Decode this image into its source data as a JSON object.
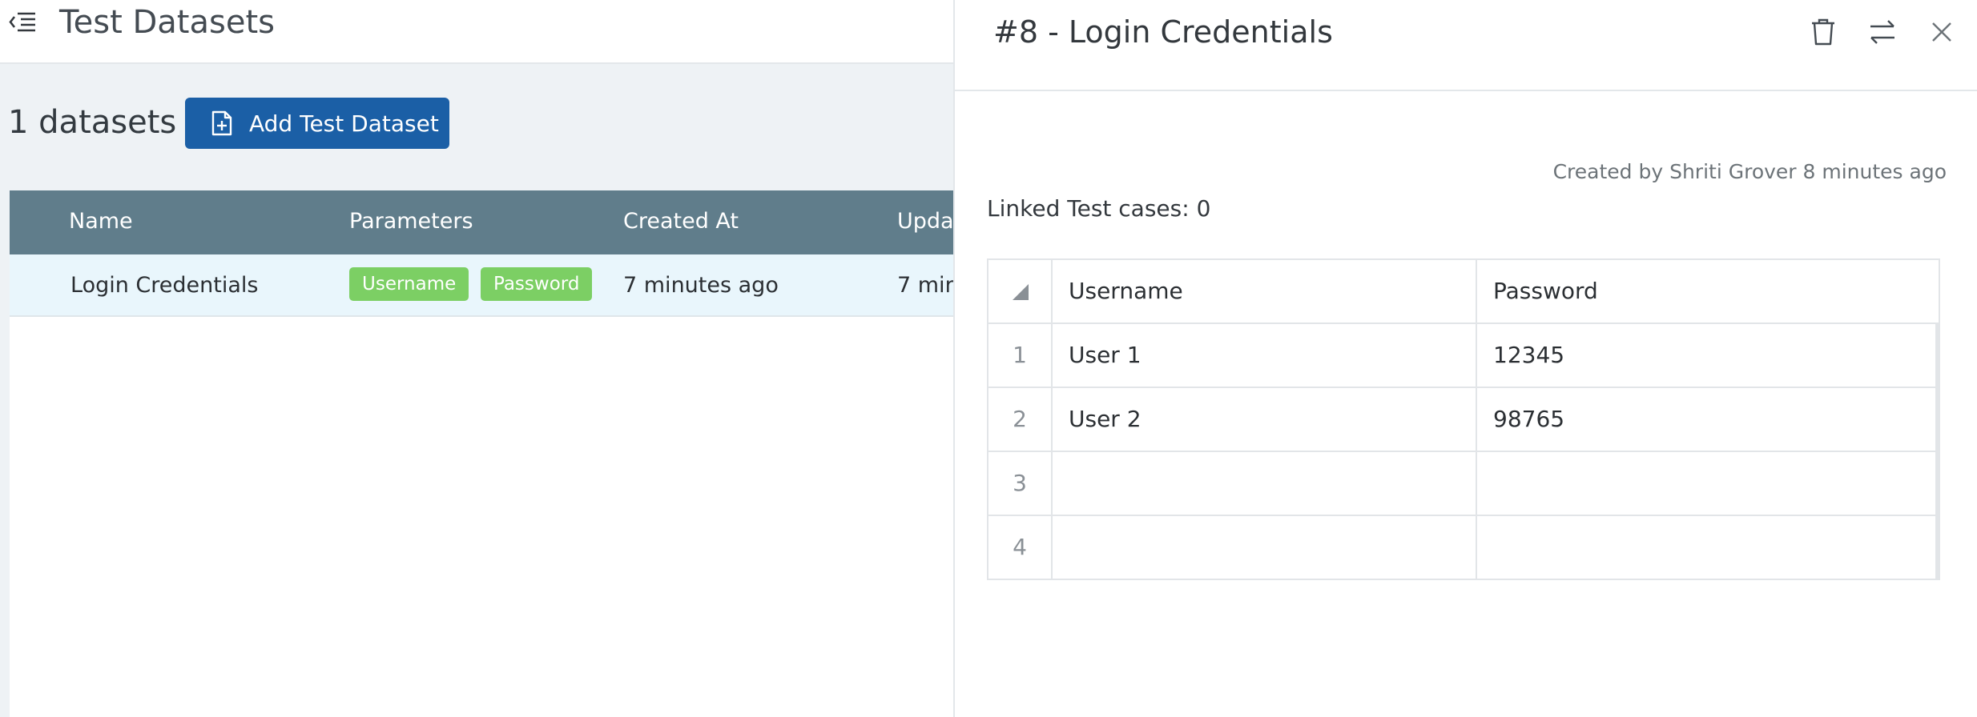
{
  "header": {
    "title": "Test Datasets",
    "menu_icon": "menu-collapse-icon"
  },
  "toolbar": {
    "count_label": "1 datasets",
    "add_button_label": "Add Test Dataset",
    "add_button_icon": "file-plus-icon"
  },
  "datasets_table": {
    "columns": [
      "Name",
      "Parameters",
      "Created At",
      "Upda"
    ],
    "rows": [
      {
        "name": "Login Credentials",
        "parameters": [
          "Username",
          "Password"
        ],
        "created_at": "7 minutes ago",
        "updated_at": "7 min"
      }
    ]
  },
  "drawer": {
    "title": "#8 - Login Credentials",
    "icons": [
      "trash-icon",
      "swap-icon",
      "close-icon"
    ],
    "created_by": "Created by Shriti Grover 8 minutes ago",
    "linked_cases": "Linked Test cases: 0",
    "grid": {
      "columns": [
        "Username",
        "Password"
      ],
      "rows": [
        {
          "index": "1",
          "values": [
            "User 1",
            "12345"
          ]
        },
        {
          "index": "2",
          "values": [
            "User 2",
            "98765"
          ]
        },
        {
          "index": "3",
          "values": [
            "",
            ""
          ]
        },
        {
          "index": "4",
          "values": [
            "",
            ""
          ]
        }
      ]
    }
  },
  "colors": {
    "primary_button": "#1b5fa6",
    "table_header": "#607d8b",
    "chip": "#7ccf64",
    "selected_row": "#e9f6fc"
  }
}
